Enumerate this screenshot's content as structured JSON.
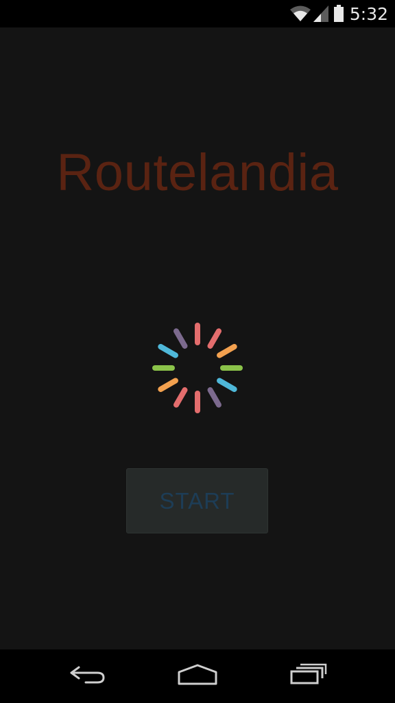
{
  "status_bar": {
    "time": "5:32",
    "icons": [
      "wifi-icon",
      "cell-signal-icon",
      "battery-icon"
    ]
  },
  "app": {
    "title": "Routelandia",
    "start_button_label": "START",
    "loading": true
  },
  "nav_bar": {
    "buttons": [
      "back-icon",
      "home-icon",
      "recent-apps-icon"
    ]
  },
  "colors": {
    "title": "#5a2312",
    "button_text": "#1d3d56",
    "button_bg": "#262a29",
    "background": "#141414",
    "spinner": [
      "#e36d6d",
      "#f3a14f",
      "#8bc34a",
      "#4fb8d9",
      "#7c6a8e"
    ]
  }
}
